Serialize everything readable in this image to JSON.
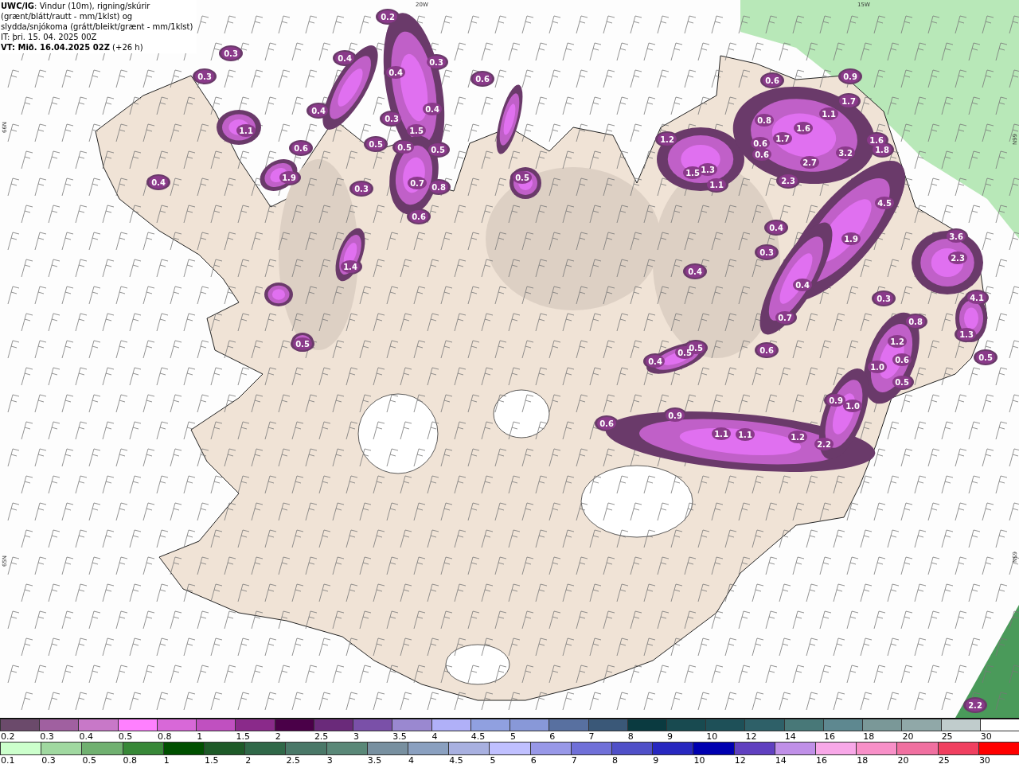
{
  "title": {
    "lines": [
      "**UWC/IG**: Vindur (10m), rigning/skúrir (grænt/blátt/rautt - mm/1klst) og slydda/snjókoma (grátt/bleikt/grænt - mm/1klst)",
      "IT: þri. 15. 04. 2025 00Z",
      "**VT: Mið. 16.04.2025 02Z** (+26 h)"
    ]
  },
  "map": {
    "grid_labels": [
      "20W",
      "15W",
      "66N",
      "65N",
      "66N",
      "65N"
    ],
    "value_labels": [
      "0.2",
      "0.3",
      "0.4",
      "0.4",
      "0.3",
      "0.3",
      "0.6",
      "1.1",
      "0.4",
      "0.3",
      "0.4",
      "1.5",
      "0.6",
      "0.5",
      "0.5",
      "0.5",
      "1.9",
      "0.4",
      "0.3",
      "0.7",
      "0.6",
      "0.8",
      "0.5",
      "1.4",
      "0.5",
      "0.6",
      "0.9",
      "1.7",
      "1.1",
      "1.6",
      "0.8",
      "1.7",
      "0.6",
      "1.2",
      "1.5",
      "1.3",
      "1.1",
      "2.7",
      "3.2",
      "1.6",
      "1.8",
      "2.3",
      "0.6",
      "4.5",
      "1.9",
      "0.4",
      "0.3",
      "0.4",
      "0.4",
      "0.3",
      "0.7",
      "3.6",
      "2.3",
      "4.1",
      "1.3",
      "0.8",
      "1.2",
      "1.0",
      "0.6",
      "0.5",
      "0.6",
      "0.4",
      "0.5",
      "0.5",
      "0.6",
      "0.9",
      "0.9",
      "1.0",
      "1.1",
      "1.1",
      "1.2",
      "2.2",
      "2.2",
      "0.5"
    ]
  },
  "legend": {
    "rows": [
      {
        "kind": "snow",
        "items": [
          {
            "label": "0.2",
            "color": "#6b4a6b"
          },
          {
            "label": "0.3",
            "color": "#a060a0"
          },
          {
            "label": "0.4",
            "color": "#c878c8"
          },
          {
            "label": "0.5",
            "color": "#ff80ff"
          },
          {
            "label": "0.8",
            "color": "#d868d8"
          },
          {
            "label": "1",
            "color": "#c050c0"
          },
          {
            "label": "1.5",
            "color": "#8a2a8a"
          },
          {
            "label": "2",
            "color": "#4a0048"
          },
          {
            "label": "2.5",
            "color": "#6a2a7a"
          },
          {
            "label": "3",
            "color": "#7a50a8"
          },
          {
            "label": "3.5",
            "color": "#9a88d0"
          },
          {
            "label": "4",
            "color": "#b0b0f8"
          },
          {
            "label": "4.5",
            "color": "#90a0e0"
          },
          {
            "label": "5",
            "color": "#8898d8"
          },
          {
            "label": "6",
            "color": "#5870a0"
          },
          {
            "label": "7",
            "color": "#3a5878"
          },
          {
            "label": "8",
            "color": "#0a3a40"
          },
          {
            "label": "9",
            "color": "#184a50"
          },
          {
            "label": "10",
            "color": "#1e5058"
          },
          {
            "label": "12",
            "color": "#2e6068"
          },
          {
            "label": "14",
            "color": "#487878"
          },
          {
            "label": "16",
            "color": "#5e8890"
          },
          {
            "label": "18",
            "color": "#7a9898"
          },
          {
            "label": "20",
            "color": "#90a8a8"
          },
          {
            "label": "25",
            "color": "#c0cccc"
          },
          {
            "label": "30",
            "color": "#ffffff"
          }
        ]
      },
      {
        "kind": "rain",
        "items": [
          {
            "label": "0.1",
            "color": "#ccffcc"
          },
          {
            "label": "0.3",
            "color": "#a0d8a0"
          },
          {
            "label": "0.5",
            "color": "#70b070"
          },
          {
            "label": "0.8",
            "color": "#388838"
          },
          {
            "label": "1",
            "color": "#005000"
          },
          {
            "label": "1.5",
            "color": "#1e5a28"
          },
          {
            "label": "2",
            "color": "#306848"
          },
          {
            "label": "2.5",
            "color": "#4a7868"
          },
          {
            "label": "3",
            "color": "#5a8878"
          },
          {
            "label": "3.5",
            "color": "#7890a0"
          },
          {
            "label": "4",
            "color": "#8aa0c0"
          },
          {
            "label": "4.5",
            "color": "#a8b0e0"
          },
          {
            "label": "5",
            "color": "#c0c0ff"
          },
          {
            "label": "6",
            "color": "#9898e8"
          },
          {
            "label": "7",
            "color": "#7070d8"
          },
          {
            "label": "8",
            "color": "#5050c8"
          },
          {
            "label": "9",
            "color": "#2828c0"
          },
          {
            "label": "10",
            "color": "#0000b0"
          },
          {
            "label": "12",
            "color": "#6040c0"
          },
          {
            "label": "14",
            "color": "#c090e8"
          },
          {
            "label": "16",
            "color": "#f8a8e8"
          },
          {
            "label": "18",
            "color": "#f890c8"
          },
          {
            "label": "20",
            "color": "#f070a0"
          },
          {
            "label": "25",
            "color": "#f04060"
          },
          {
            "label": "30",
            "color": "#ff0000"
          }
        ]
      }
    ]
  }
}
